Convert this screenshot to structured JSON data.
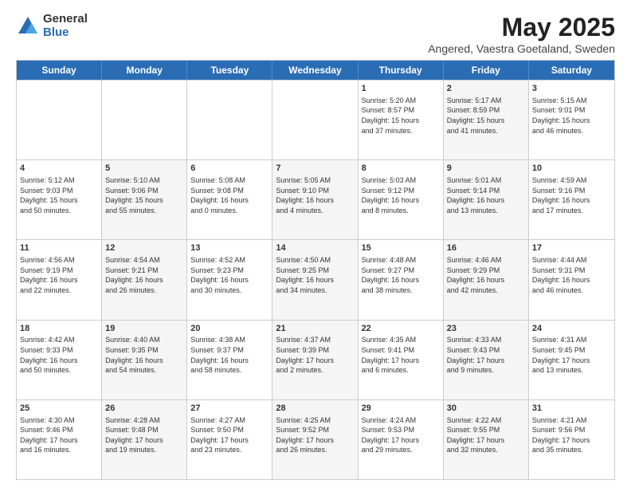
{
  "logo": {
    "general": "General",
    "blue": "Blue"
  },
  "title": {
    "month_year": "May 2025",
    "location": "Angered, Vaestra Goetaland, Sweden"
  },
  "header_days": [
    "Sunday",
    "Monday",
    "Tuesday",
    "Wednesday",
    "Thursday",
    "Friday",
    "Saturday"
  ],
  "rows": [
    [
      {
        "day": "",
        "info": "",
        "alt": false
      },
      {
        "day": "",
        "info": "",
        "alt": false
      },
      {
        "day": "",
        "info": "",
        "alt": false
      },
      {
        "day": "",
        "info": "",
        "alt": false
      },
      {
        "day": "1",
        "info": "Sunrise: 5:20 AM\nSunset: 8:57 PM\nDaylight: 15 hours\nand 37 minutes.",
        "alt": false
      },
      {
        "day": "2",
        "info": "Sunrise: 5:17 AM\nSunset: 8:59 PM\nDaylight: 15 hours\nand 41 minutes.",
        "alt": true
      },
      {
        "day": "3",
        "info": "Sunrise: 5:15 AM\nSunset: 9:01 PM\nDaylight: 15 hours\nand 46 minutes.",
        "alt": false
      }
    ],
    [
      {
        "day": "4",
        "info": "Sunrise: 5:12 AM\nSunset: 9:03 PM\nDaylight: 15 hours\nand 50 minutes.",
        "alt": false
      },
      {
        "day": "5",
        "info": "Sunrise: 5:10 AM\nSunset: 9:06 PM\nDaylight: 15 hours\nand 55 minutes.",
        "alt": true
      },
      {
        "day": "6",
        "info": "Sunrise: 5:08 AM\nSunset: 9:08 PM\nDaylight: 16 hours\nand 0 minutes.",
        "alt": false
      },
      {
        "day": "7",
        "info": "Sunrise: 5:05 AM\nSunset: 9:10 PM\nDaylight: 16 hours\nand 4 minutes.",
        "alt": true
      },
      {
        "day": "8",
        "info": "Sunrise: 5:03 AM\nSunset: 9:12 PM\nDaylight: 16 hours\nand 8 minutes.",
        "alt": false
      },
      {
        "day": "9",
        "info": "Sunrise: 5:01 AM\nSunset: 9:14 PM\nDaylight: 16 hours\nand 13 minutes.",
        "alt": true
      },
      {
        "day": "10",
        "info": "Sunrise: 4:59 AM\nSunset: 9:16 PM\nDaylight: 16 hours\nand 17 minutes.",
        "alt": false
      }
    ],
    [
      {
        "day": "11",
        "info": "Sunrise: 4:56 AM\nSunset: 9:19 PM\nDaylight: 16 hours\nand 22 minutes.",
        "alt": false
      },
      {
        "day": "12",
        "info": "Sunrise: 4:54 AM\nSunset: 9:21 PM\nDaylight: 16 hours\nand 26 minutes.",
        "alt": true
      },
      {
        "day": "13",
        "info": "Sunrise: 4:52 AM\nSunset: 9:23 PM\nDaylight: 16 hours\nand 30 minutes.",
        "alt": false
      },
      {
        "day": "14",
        "info": "Sunrise: 4:50 AM\nSunset: 9:25 PM\nDaylight: 16 hours\nand 34 minutes.",
        "alt": true
      },
      {
        "day": "15",
        "info": "Sunrise: 4:48 AM\nSunset: 9:27 PM\nDaylight: 16 hours\nand 38 minutes.",
        "alt": false
      },
      {
        "day": "16",
        "info": "Sunrise: 4:46 AM\nSunset: 9:29 PM\nDaylight: 16 hours\nand 42 minutes.",
        "alt": true
      },
      {
        "day": "17",
        "info": "Sunrise: 4:44 AM\nSunset: 9:31 PM\nDaylight: 16 hours\nand 46 minutes.",
        "alt": false
      }
    ],
    [
      {
        "day": "18",
        "info": "Sunrise: 4:42 AM\nSunset: 9:33 PM\nDaylight: 16 hours\nand 50 minutes.",
        "alt": false
      },
      {
        "day": "19",
        "info": "Sunrise: 4:40 AM\nSunset: 9:35 PM\nDaylight: 16 hours\nand 54 minutes.",
        "alt": true
      },
      {
        "day": "20",
        "info": "Sunrise: 4:38 AM\nSunset: 9:37 PM\nDaylight: 16 hours\nand 58 minutes.",
        "alt": false
      },
      {
        "day": "21",
        "info": "Sunrise: 4:37 AM\nSunset: 9:39 PM\nDaylight: 17 hours\nand 2 minutes.",
        "alt": true
      },
      {
        "day": "22",
        "info": "Sunrise: 4:35 AM\nSunset: 9:41 PM\nDaylight: 17 hours\nand 6 minutes.",
        "alt": false
      },
      {
        "day": "23",
        "info": "Sunrise: 4:33 AM\nSunset: 9:43 PM\nDaylight: 17 hours\nand 9 minutes.",
        "alt": true
      },
      {
        "day": "24",
        "info": "Sunrise: 4:31 AM\nSunset: 9:45 PM\nDaylight: 17 hours\nand 13 minutes.",
        "alt": false
      }
    ],
    [
      {
        "day": "25",
        "info": "Sunrise: 4:30 AM\nSunset: 9:46 PM\nDaylight: 17 hours\nand 16 minutes.",
        "alt": false
      },
      {
        "day": "26",
        "info": "Sunrise: 4:28 AM\nSunset: 9:48 PM\nDaylight: 17 hours\nand 19 minutes.",
        "alt": true
      },
      {
        "day": "27",
        "info": "Sunrise: 4:27 AM\nSunset: 9:50 PM\nDaylight: 17 hours\nand 23 minutes.",
        "alt": false
      },
      {
        "day": "28",
        "info": "Sunrise: 4:25 AM\nSunset: 9:52 PM\nDaylight: 17 hours\nand 26 minutes.",
        "alt": true
      },
      {
        "day": "29",
        "info": "Sunrise: 4:24 AM\nSunset: 9:53 PM\nDaylight: 17 hours\nand 29 minutes.",
        "alt": false
      },
      {
        "day": "30",
        "info": "Sunrise: 4:22 AM\nSunset: 9:55 PM\nDaylight: 17 hours\nand 32 minutes.",
        "alt": true
      },
      {
        "day": "31",
        "info": "Sunrise: 4:21 AM\nSunset: 9:56 PM\nDaylight: 17 hours\nand 35 minutes.",
        "alt": false
      }
    ]
  ]
}
